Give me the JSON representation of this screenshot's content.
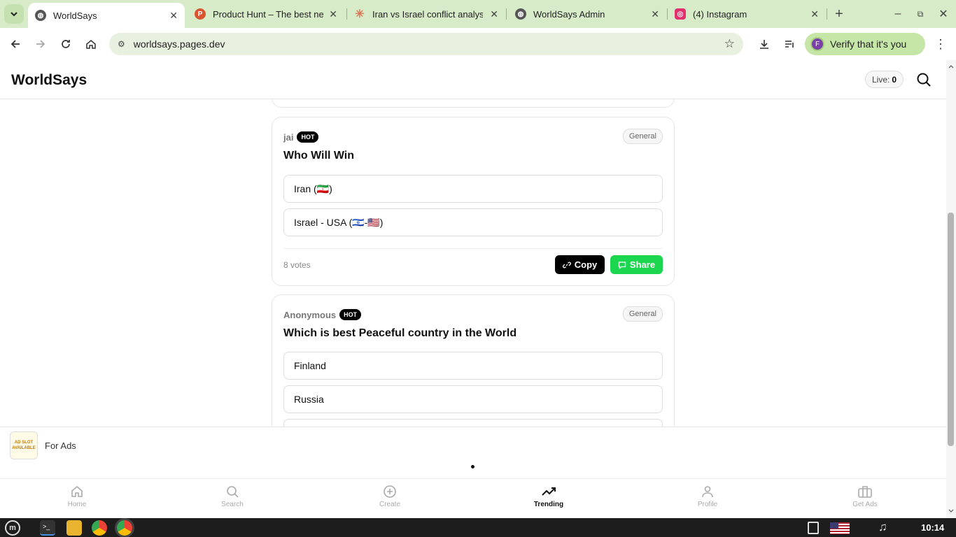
{
  "browser": {
    "tabs": [
      {
        "title": "WorldSays",
        "active": true
      },
      {
        "title": "Product Hunt – The best new",
        "active": false
      },
      {
        "title": "Iran vs Israel conflict analysis",
        "active": false
      },
      {
        "title": "WorldSays Admin",
        "active": false
      },
      {
        "title": "(4) Instagram",
        "active": false
      }
    ],
    "url": "worldsays.pages.dev",
    "verify_label": "Verify that it's you",
    "profile_initial": "F"
  },
  "site": {
    "logo": "WorldSays",
    "live_label": "Live:",
    "live_count": "0"
  },
  "polls": [
    {
      "author": "jai",
      "badge": "HOT",
      "category": "General",
      "question": "Who Will Win",
      "options": [
        "Iran (🇮🇷)",
        "Israel - USA (🇮🇱-🇺🇸)"
      ],
      "votes": "8 votes",
      "copy_label": "Copy",
      "share_label": "Share"
    },
    {
      "author": "Anonymous",
      "badge": "HOT",
      "category": "General",
      "question": "Which is best Peaceful country in the World",
      "options": [
        "Finland",
        "Russia"
      ]
    }
  ],
  "ad": {
    "label": "For Ads",
    "logo_text": "AD SLOT AVAILABLE"
  },
  "bottom_nav": [
    {
      "label": "Home",
      "icon": "home-icon",
      "active": false
    },
    {
      "label": "Search",
      "icon": "search-icon",
      "active": false
    },
    {
      "label": "Create",
      "icon": "plus-circle-icon",
      "active": false
    },
    {
      "label": "Trending",
      "icon": "trending-icon",
      "active": true
    },
    {
      "label": "Profile",
      "icon": "user-icon",
      "active": false
    },
    {
      "label": "Get Ads",
      "icon": "briefcase-icon",
      "active": false
    }
  ],
  "taskbar": {
    "clock": "10:14"
  },
  "colors": {
    "share_green": "#1cd64f",
    "chrome_frame": "#d7ebc9"
  }
}
